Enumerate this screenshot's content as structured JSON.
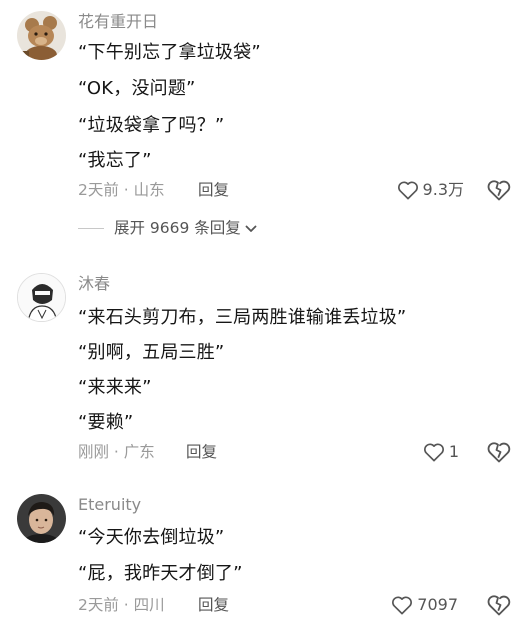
{
  "comments": [
    {
      "username": "花有重开日",
      "lines": [
        "“下午别忘了拿垃圾袋”",
        "“OK，没问题”",
        "“垃圾袋拿了吗？”",
        "“我忘了”"
      ],
      "time": "2天前 · 山东",
      "reply_label": "回复",
      "likes": "9.3万",
      "expand_label": "展开 9669 条回复"
    },
    {
      "username": "沐春",
      "lines": [
        "“来石头剪刀布，三局两胜谁输谁丢垃圾”",
        "“别啊，五局三胜”",
        "“来来来”",
        "“要赖”"
      ],
      "time": "刚刚 · 广东",
      "reply_label": "回复",
      "likes": "1"
    },
    {
      "username": "Eteruity",
      "lines": [
        "“今天你去倒垃圾”",
        "“屁，我昨天才倒了”"
      ],
      "time": "2天前 · 四川",
      "reply_label": "回复",
      "likes": "7097"
    }
  ],
  "icons": {
    "like": "heart-outline-icon",
    "dislike": "broken-heart-icon",
    "expand": "chevron-down-icon"
  }
}
